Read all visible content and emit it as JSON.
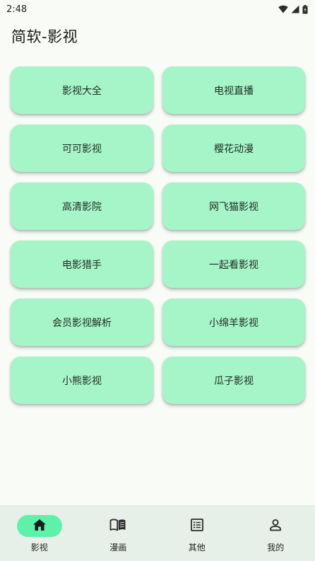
{
  "status_bar": {
    "time": "2:48",
    "icons": [
      "wifi-icon",
      "signal-icon",
      "battery-icon"
    ]
  },
  "app": {
    "title": "简软-影视"
  },
  "tiles": [
    "影视大全",
    "电视直播",
    "可可影视",
    "樱花动漫",
    "高清影院",
    "网飞猫影视",
    "电影猎手",
    "一起看影视",
    "会员影视解析",
    "小绵羊影视",
    "小熊影视",
    "瓜子影视"
  ],
  "nav": {
    "items": [
      {
        "label": "影视",
        "icon": "home-icon",
        "active": true
      },
      {
        "label": "漫画",
        "icon": "book-open-icon",
        "active": false
      },
      {
        "label": "其他",
        "icon": "list-icon",
        "active": false
      },
      {
        "label": "我的",
        "icon": "person-icon",
        "active": false
      }
    ]
  },
  "colors": {
    "background": "#f8fbf6",
    "tile": "#a6f5c8",
    "nav_background": "#e6efe8",
    "nav_active": "#5ef2a8"
  }
}
